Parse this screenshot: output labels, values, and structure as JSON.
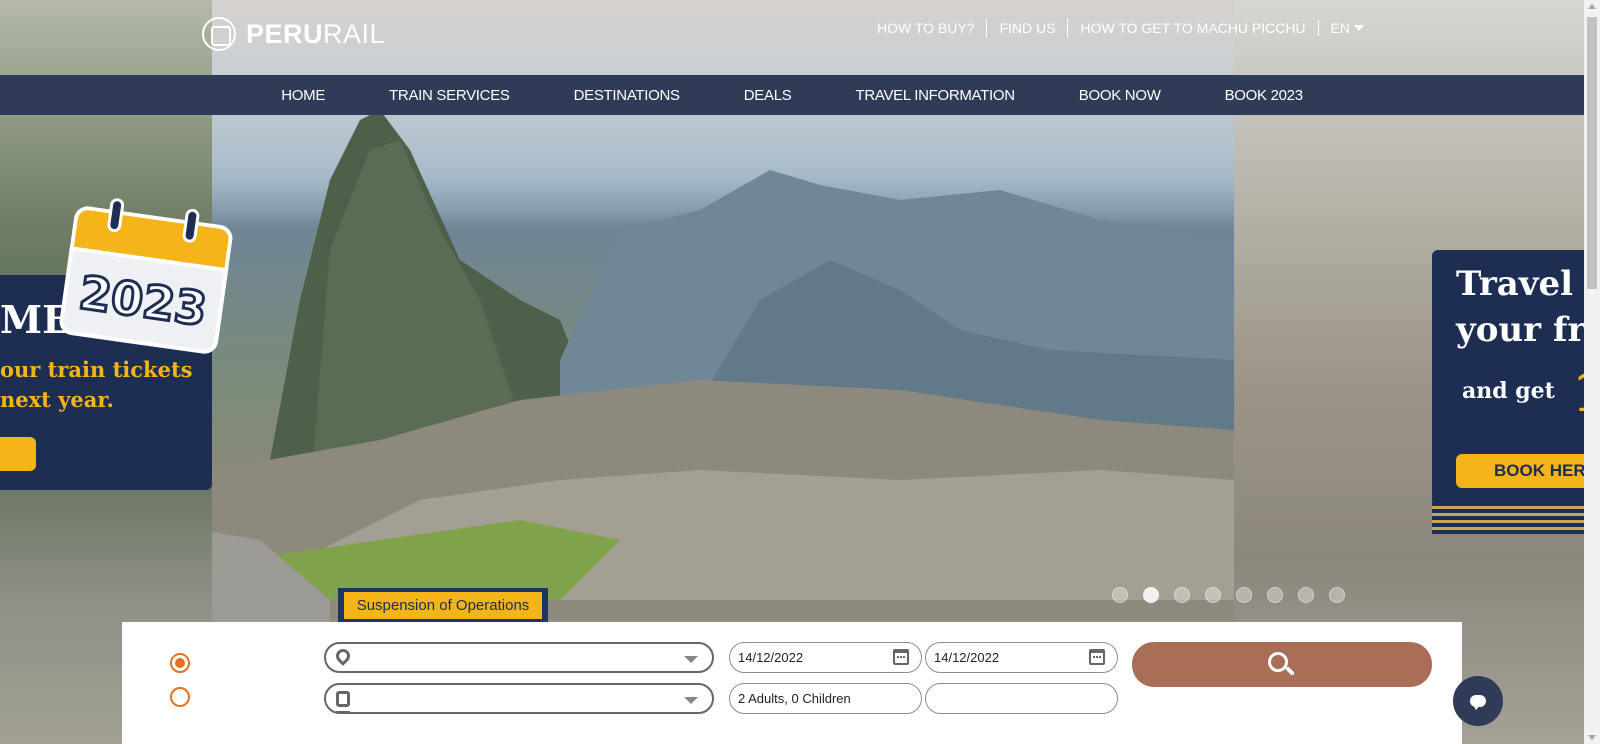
{
  "header": {
    "logo_text_bold": "PERU",
    "logo_text_light": "RAIL",
    "links": [
      "HOW TO BUY?",
      "FIND US",
      "HOW TO GET TO MACHU PICCHU"
    ],
    "language": "EN"
  },
  "nav": {
    "items": [
      "HOME",
      "TRAIN SERVICES",
      "DESTINATIONS",
      "DEALS",
      "TRAVEL INFORMATION",
      "BOOK NOW",
      "BOOK 2023"
    ]
  },
  "promo_left": {
    "headline": "ME",
    "line1": "our train tickets",
    "line2": "next year.",
    "calendar_year": "2023"
  },
  "promo_right": {
    "line1": "Travel",
    "line2": "your fr",
    "line3": "and get",
    "big_number": "1",
    "button_label": "BOOK HERE"
  },
  "carousel": {
    "slide_count": 8,
    "active_index": 1
  },
  "notice_tab": "Suspension of Operations",
  "booking": {
    "trip_type_selected": 0,
    "route_value": "",
    "train_value": "",
    "date_from": "14/12/2022",
    "date_to": "14/12/2022",
    "passengers": "2 Adults, 0 Children",
    "promo_code": ""
  },
  "colors": {
    "nav_bg": "#2f3b57",
    "accent_orange": "#e37222",
    "promo_yellow": "#f4b41a",
    "promo_navy": "#1e2d52",
    "search_button": "#a96e55"
  },
  "icons": {
    "location": "map-pin-icon",
    "train": "train-icon",
    "calendar": "calendar-icon",
    "search": "search-icon",
    "chat": "chat-bubble-icon"
  }
}
